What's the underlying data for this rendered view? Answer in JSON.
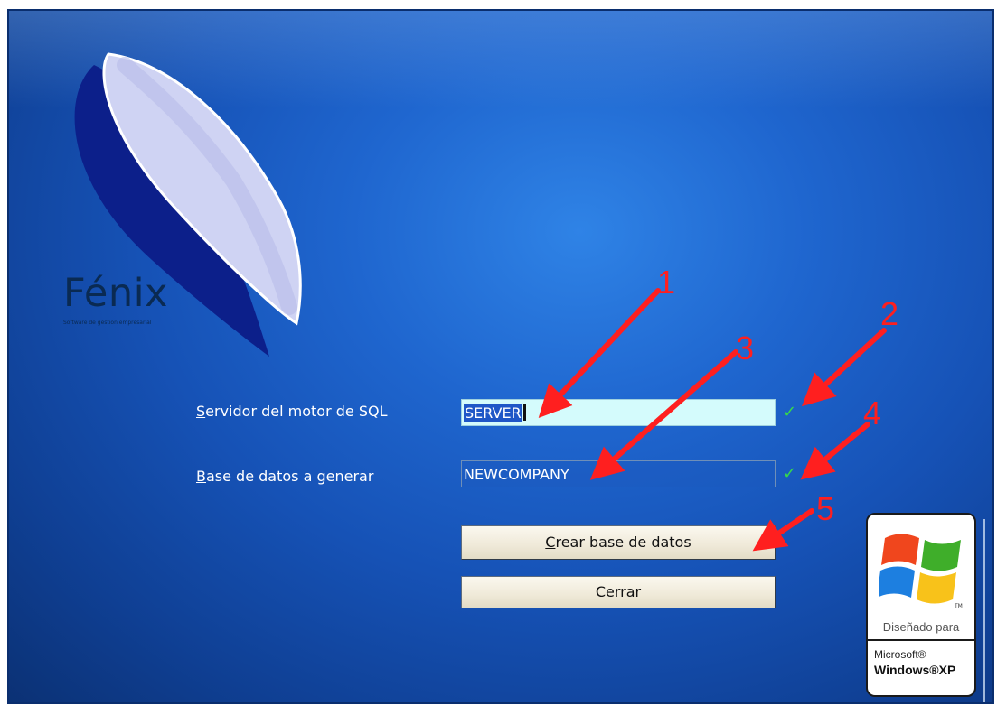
{
  "app": {
    "name": "Fénix",
    "tagline": "Software de gestión empresarial"
  },
  "form": {
    "server_label_accel": "S",
    "server_label_rest": "ervidor del motor de SQL",
    "server_value": "SERVER",
    "database_label_accel": "B",
    "database_label_rest": "ase de datos a generar",
    "database_value": "NEWCOMPANY"
  },
  "buttons": {
    "create_accel": "C",
    "create_rest": "rear base de datos",
    "close_label": "Cerrar"
  },
  "badge": {
    "designed_for": "Diseñado para",
    "microsoft": "Microsoft®",
    "windows_xp": "Windows®XP",
    "tm": "TM"
  },
  "annotations": {
    "markers": [
      "1",
      "2",
      "3",
      "4",
      "5"
    ]
  },
  "colors": {
    "annotation": "#ff1f1f",
    "check": "#36d84a",
    "active_field": "#d4fbfc"
  }
}
